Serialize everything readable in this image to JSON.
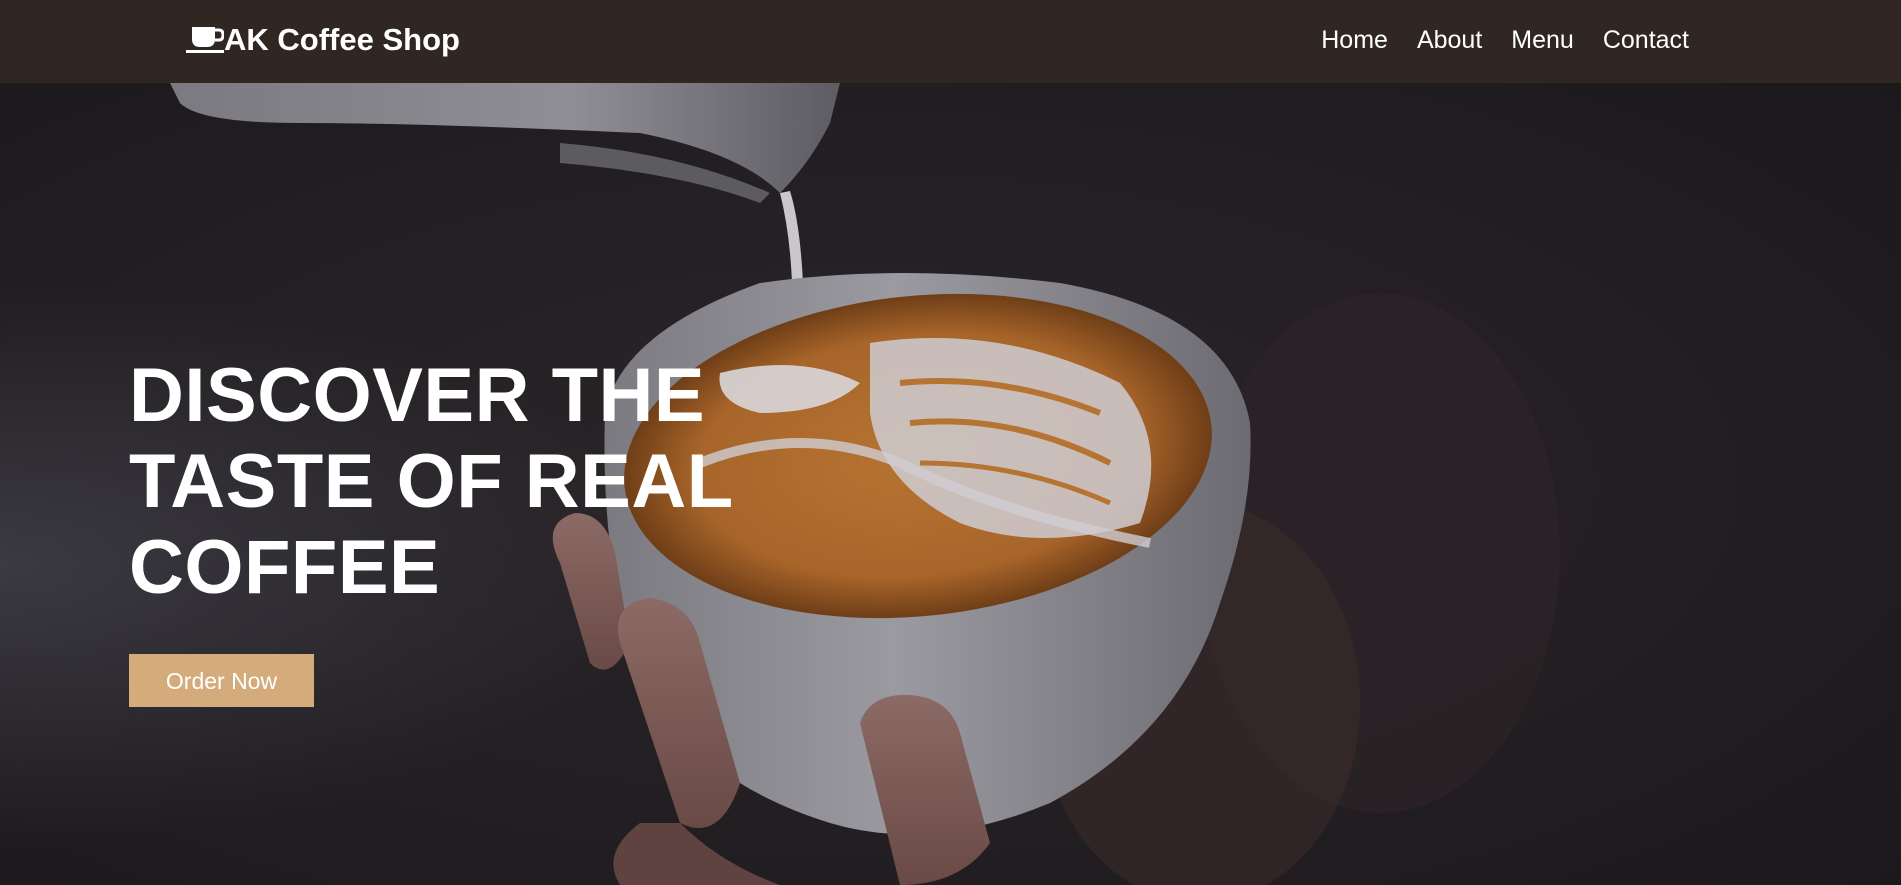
{
  "navbar": {
    "brand": "AK Coffee Shop",
    "brand_icon": "coffee-cup-icon",
    "links": [
      "Home",
      "About",
      "Menu",
      "Contact"
    ]
  },
  "hero": {
    "title": "DISCOVER THE TASTE OF REAL COFFEE",
    "button_label": "Order Now",
    "background_image": "latte-art-pour-photo"
  },
  "colors": {
    "navbar_bg": "#302722",
    "button_bg": "#d4ac7b",
    "text": "#ffffff"
  }
}
